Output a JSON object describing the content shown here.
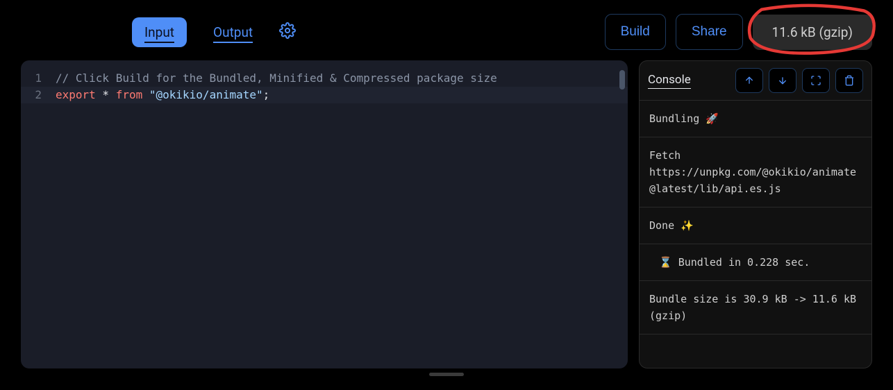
{
  "tabs": {
    "input": "Input",
    "output": "Output"
  },
  "actions": {
    "build": "Build",
    "share": "Share"
  },
  "size_badge": "11.6 kB (gzip)",
  "editor": {
    "lines": [
      {
        "num": "1",
        "comment": "// Click Build for the Bundled, Minified & Compressed package size"
      },
      {
        "num": "2",
        "kw1": "export",
        "mid": " * ",
        "kw2": "from",
        "str": " \"@okikio/animate\"",
        "tail": ";"
      }
    ]
  },
  "console": {
    "title": "Console",
    "entries": {
      "bundling": "Bundling 🚀",
      "fetch_label": "Fetch",
      "fetch_url": "https://unpkg.com/@okikio/animate@latest/lib/api.es.js",
      "done": "Done ✨",
      "timing": "⌛ Bundled in 0.228 sec.",
      "size": "Bundle size is 30.9 kB -> 11.6 kB (gzip)"
    }
  }
}
